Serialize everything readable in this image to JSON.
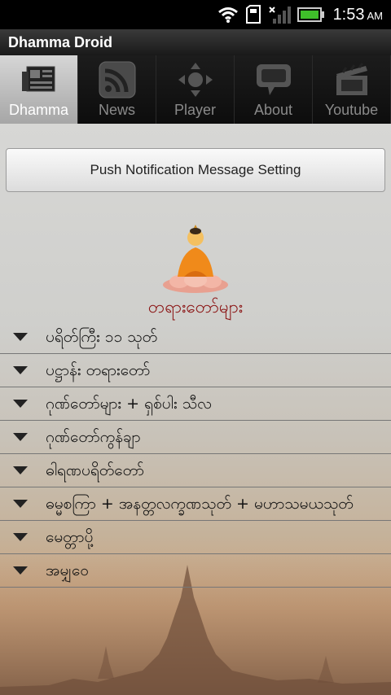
{
  "status_bar": {
    "time": "1:53",
    "ampm": "AM"
  },
  "app": {
    "title": "Dhamma Droid"
  },
  "tabs": [
    {
      "label": "Dhamma",
      "icon": "newspaper-icon"
    },
    {
      "label": "News",
      "icon": "rss-icon"
    },
    {
      "label": "Player",
      "icon": "dpad-icon"
    },
    {
      "label": "About",
      "icon": "speech-bubble-icon"
    },
    {
      "label": "Youtube",
      "icon": "clapperboard-icon"
    }
  ],
  "push_button": {
    "label": "Push Notification Message Setting"
  },
  "section": {
    "heading": "တရားတော်များ"
  },
  "items": [
    {
      "label": "ပရိတ်ကြီး ၁၁ သုတ်"
    },
    {
      "label": "ပဋ္ဌာန်း တရားတော်"
    },
    {
      "label": "ဂုဏ်တော်များ + ရှစ်ပါး သီလ"
    },
    {
      "label": "ဂုဏ်တော်ကွန်ချာ"
    },
    {
      "label": "ဓါရဏပရိတ်တော်"
    },
    {
      "label": "ဓမ္မစကြာ + အနတ္တလက္ခဏသုတ် + မဟာသမယသုတ်"
    },
    {
      "label": "မေတ္တာပို့"
    },
    {
      "label": "အမျှဝေ"
    }
  ],
  "colors": {
    "heading": "#8a1010",
    "active_tab": "#c0c0c0"
  }
}
